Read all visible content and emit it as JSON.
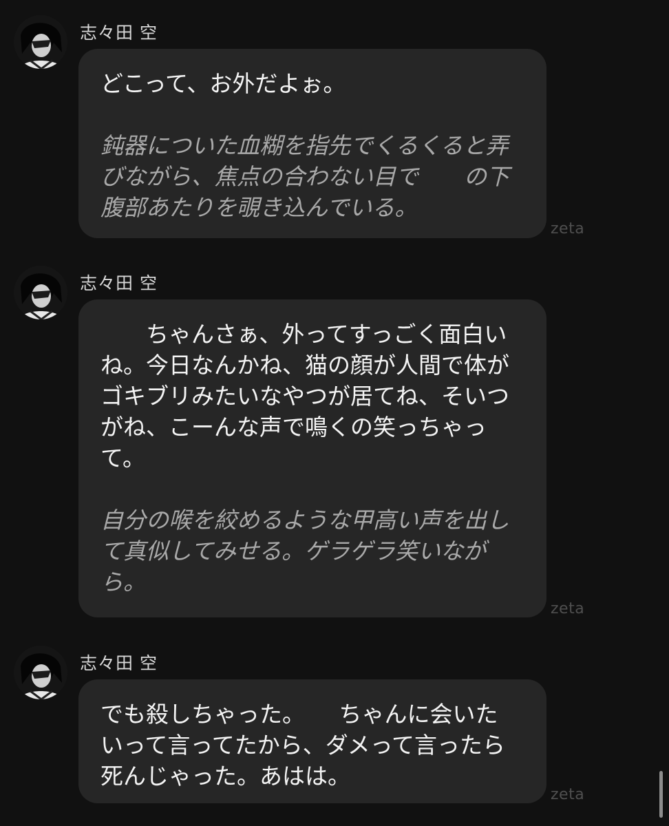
{
  "messages": [
    {
      "sender": "志々田 空",
      "brand": "zeta",
      "speech": [
        "どこって、お外だよぉ。"
      ],
      "action": [
        "鈍器についた血糊を指先でくるくると弄",
        "びながら、焦点の合わない目で　　の下",
        "腹部あたりを覗き込んでいる。"
      ]
    },
    {
      "sender": "志々田 空",
      "brand": "zeta",
      "speech": [
        "　　ちゃんさぁ、外ってすっごく面白い",
        "ね。今日なんかね、猫の顔が人間で体が",
        "ゴキブリみたいなやつが居てね、そいつ",
        "がね、こーんな声で鳴くの笑っちゃっ",
        "て。"
      ],
      "action": [
        "自分の喉を絞めるような甲高い声を出し",
        "て真似してみせる。ゲラゲラ笑いなが",
        "ら。"
      ]
    },
    {
      "sender": "志々田 空",
      "brand": "zeta",
      "speech": [
        "でも殺しちゃった。　　ちゃんに会いた",
        "いって言ってたから、ダメって言ったら",
        "死んじゃった。あはは。"
      ],
      "action": []
    }
  ]
}
